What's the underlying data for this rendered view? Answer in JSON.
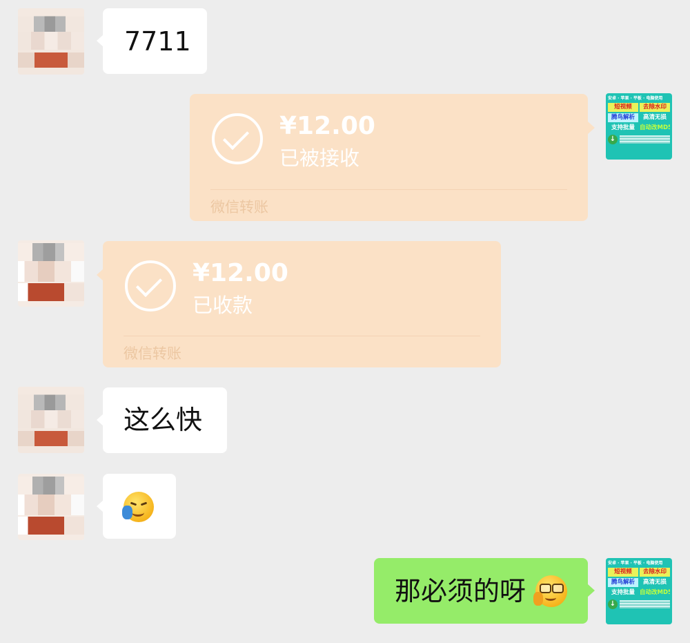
{
  "messages": {
    "m1_text": "7711",
    "transfer_sent": {
      "amount": "¥12.00",
      "status": "已被接收",
      "footer": "微信转账"
    },
    "transfer_received": {
      "amount": "¥12.00",
      "status": "已收款",
      "footer": "微信转账"
    },
    "m4_text": "这么快",
    "m5_emoji": "facepalm-laugh-emoji",
    "m6_text": "那必须的呀",
    "m6_emoji": "smirk-glasses-emoji"
  },
  "avatars": {
    "other_user": "blurred-avatar",
    "self_ad": {
      "top_line": "安卓 · 苹果 · 平板 · 电脑使用",
      "cell1": "短视频",
      "cell2": "去除水印",
      "cell3": "腾鸟解析",
      "cell4": "高清无损",
      "cell5": "支持批量",
      "cell6": "自动改MD5"
    }
  },
  "colors": {
    "background": "#ededed",
    "incoming_bubble": "#ffffff",
    "outgoing_bubble": "#95ec69",
    "transfer_card": "#fbe1c6"
  }
}
